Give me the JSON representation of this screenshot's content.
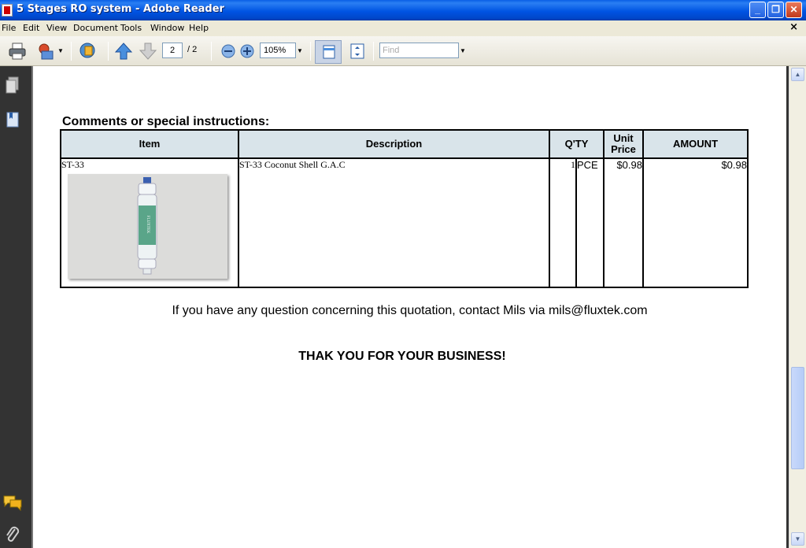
{
  "window": {
    "title": "5 Stages RO system - Adobe Reader"
  },
  "menu": [
    "File",
    "Edit",
    "View",
    "Document",
    "Tools",
    "Window",
    "Help"
  ],
  "toolbar": {
    "current_page": "2",
    "page_total": "/ 2",
    "zoom": "105%",
    "find_placeholder": "Find"
  },
  "document": {
    "comments_heading": "Comments or special instructions:",
    "table_headers": {
      "item": "Item",
      "description": "Description",
      "qty": "Q'TY",
      "unit_price": "Unit Price",
      "amount": "AMOUNT"
    },
    "row": {
      "item": "ST-33",
      "description": "ST-33 Coconut Shell G.A.C",
      "qty": "1",
      "unit": "PCE",
      "unit_price": "$0.98",
      "amount": "$0.98"
    },
    "product_label": "FLUXTEK",
    "contact_line": "If you have any question concerning this quotation, contact Mils via mils@fluxtek.com",
    "thanks": "THAK YOU FOR YOUR BUSINESS!"
  },
  "colors": {
    "titlebar": "#0054e3",
    "header_bg": "#d9e4ea",
    "sidepanel": "#333333"
  }
}
